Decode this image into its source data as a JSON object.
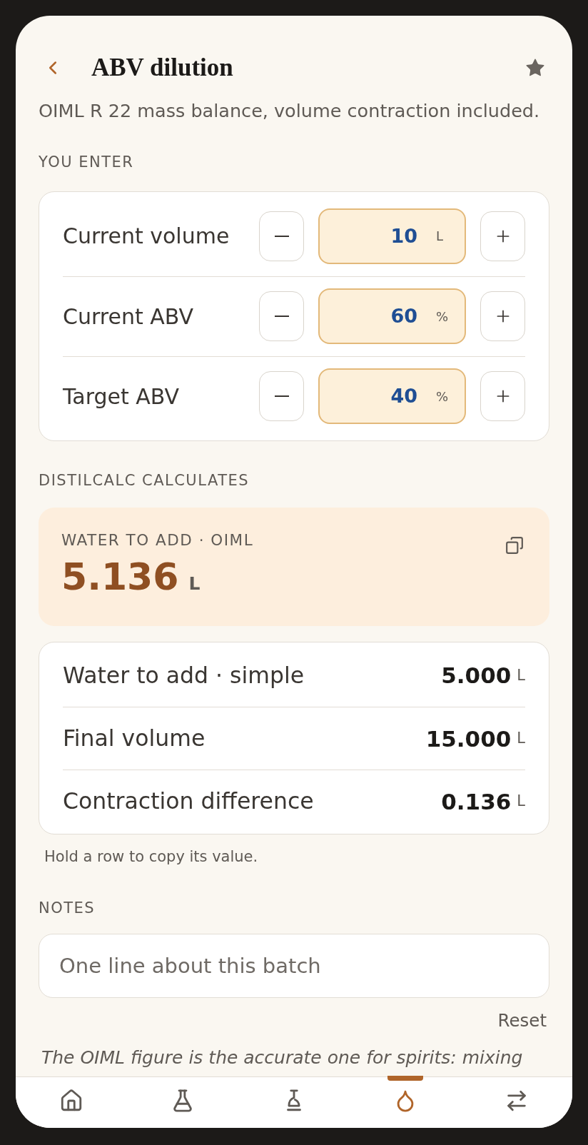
{
  "header": {
    "title": "ABV dilution",
    "favorite": true
  },
  "subtitle": "OIML R 22 mass balance, volume contraction included.",
  "inputs": {
    "label": "YOU ENTER",
    "fields": [
      {
        "label": "Current volume",
        "value": "10",
        "unit": "L"
      },
      {
        "label": "Current ABV",
        "value": "60",
        "unit": "%"
      },
      {
        "label": "Target ABV",
        "value": "40",
        "unit": "%"
      }
    ]
  },
  "results": {
    "label": "DISTILCALC CALCULATES",
    "main": {
      "label": "WATER TO ADD · OIML",
      "value": "5.136",
      "unit": "L"
    },
    "rows": [
      {
        "label": "Water to add · simple",
        "value": "5.000",
        "unit": "L"
      },
      {
        "label": "Final volume",
        "value": "15.000",
        "unit": "L"
      },
      {
        "label": "Contraction difference",
        "value": "0.136",
        "unit": "L"
      }
    ],
    "hint": "Hold a row to copy its value."
  },
  "notes": {
    "label": "NOTES",
    "placeholder": "One line about this batch",
    "reset": "Reset"
  },
  "footnote": "The OIML figure is the accurate one for spirits: mixing",
  "nav": [
    {
      "kind": "home",
      "selected": false
    },
    {
      "kind": "flask",
      "selected": false
    },
    {
      "kind": "still",
      "selected": false
    },
    {
      "kind": "drop",
      "selected": true
    },
    {
      "kind": "convert",
      "selected": false
    }
  ]
}
